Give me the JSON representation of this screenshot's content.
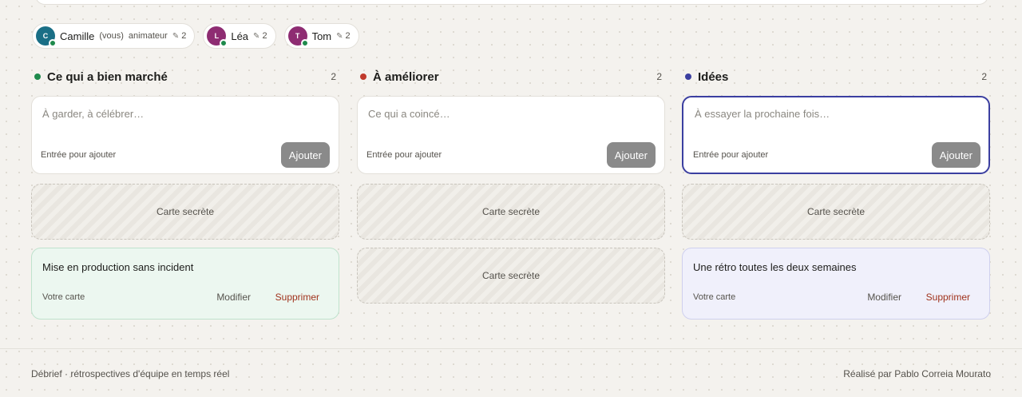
{
  "participants": [
    {
      "initial": "C",
      "name": "Camille",
      "you": "(vous)",
      "role": "animateur",
      "count": "2",
      "color": "#1a6f86"
    },
    {
      "initial": "L",
      "name": "Léa",
      "count": "2",
      "color": "#8e2c72"
    },
    {
      "initial": "T",
      "name": "Tom",
      "count": "2",
      "color": "#8e2c72"
    }
  ],
  "columns": [
    {
      "title": "Ce qui a bien marché",
      "count": "2",
      "dot_color": "#1f8a4c",
      "placeholder": "À garder, à célébrer…",
      "hint": "Entrée pour ajouter",
      "add_label": "Ajouter",
      "secret_label": "Carte secrète",
      "card": {
        "text": "Mise en production sans incident",
        "owner": "Votre carte",
        "edit": "Modifier",
        "delete": "Supprimer"
      }
    },
    {
      "title": "À améliorer",
      "count": "2",
      "dot_color": "#c0392b",
      "placeholder": "Ce qui a coincé…",
      "hint": "Entrée pour ajouter",
      "add_label": "Ajouter",
      "secrets": [
        "Carte secrète",
        "Carte secrète"
      ]
    },
    {
      "title": "Idées",
      "count": "2",
      "dot_color": "#3b3fa0",
      "placeholder": "À essayer la prochaine fois…",
      "hint": "Entrée pour ajouter",
      "add_label": "Ajouter",
      "secret_label": "Carte secrète",
      "card": {
        "text": "Une rétro toutes les deux semaines",
        "owner": "Votre carte",
        "edit": "Modifier",
        "delete": "Supprimer"
      }
    }
  ],
  "footer": {
    "left": "Débrief · rétrospectives d'équipe en temps réel",
    "right": "Réalisé par Pablo Correia Mourato"
  }
}
